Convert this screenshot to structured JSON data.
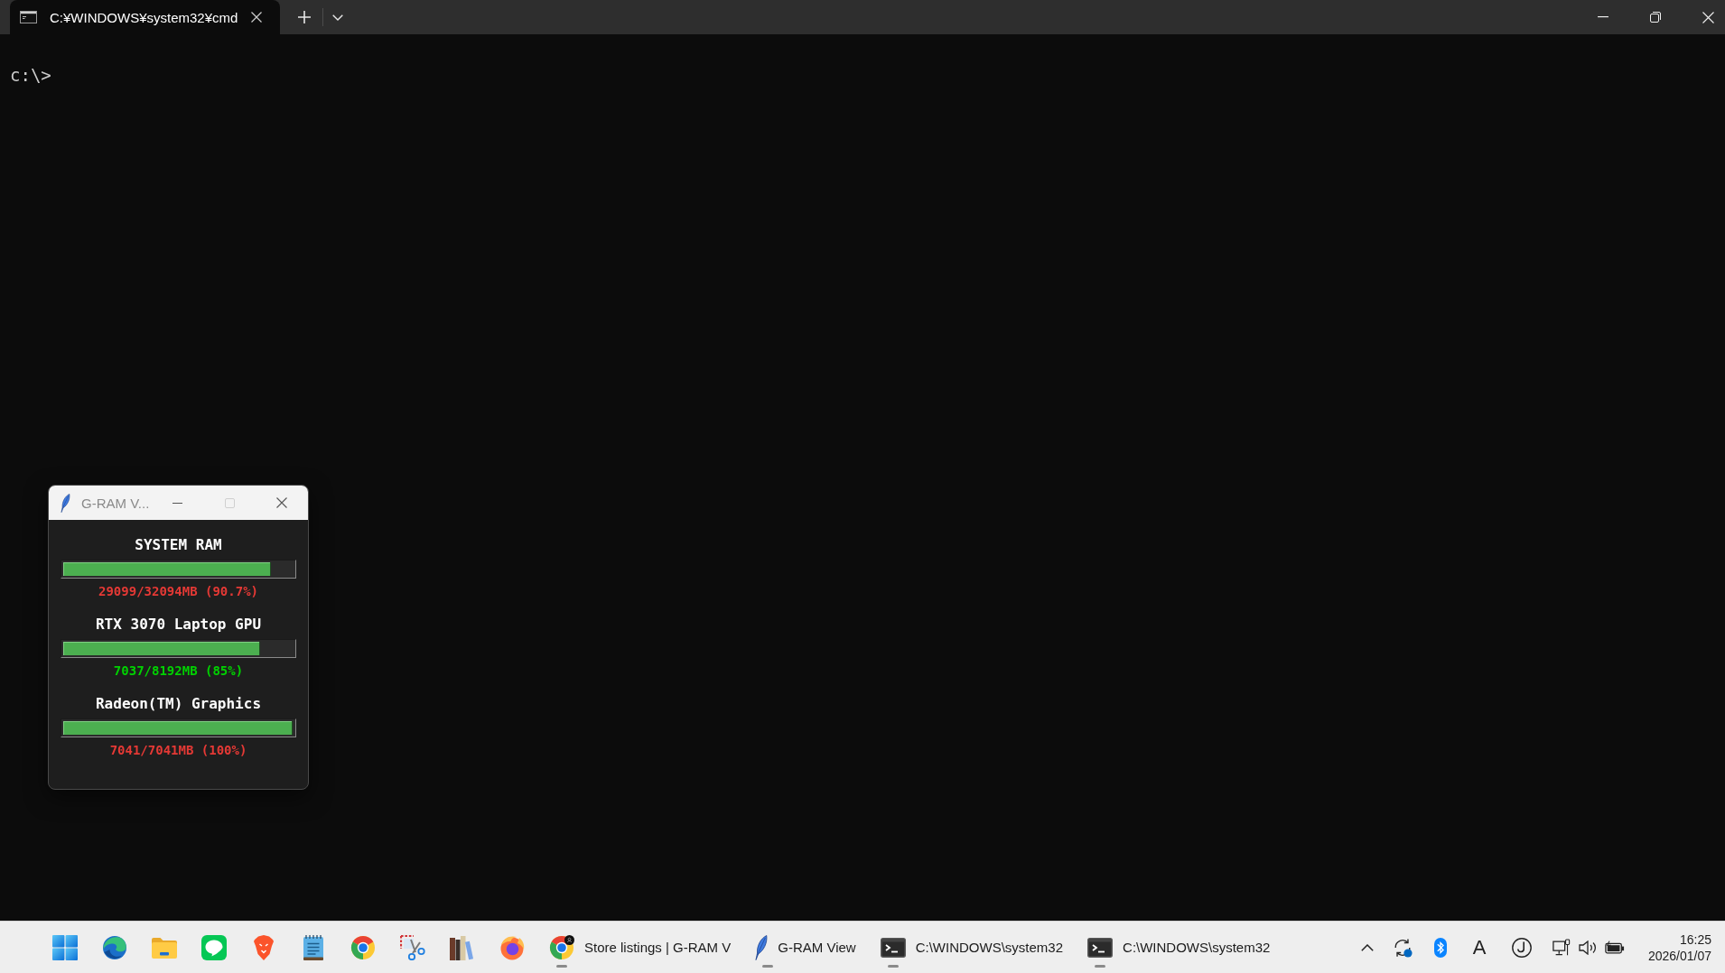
{
  "window": {
    "tabs": [
      {
        "title": "C:¥WINDOWS¥system32¥cmd",
        "selected": true
      }
    ]
  },
  "terminal": {
    "lines": [
      "c:\\>"
    ]
  },
  "gram_window": {
    "title": "G-RAM V...",
    "active": false,
    "maximize_disabled": true,
    "meters": [
      {
        "name": "SYSTEM RAM",
        "level": 0.907,
        "reading": "29099/32094MB (90.7%)",
        "color": "#e53935"
      },
      {
        "name": "RTX 3070 Laptop GPU",
        "level": 0.859,
        "reading": "7037/8192MB (85%)",
        "color": "#00d200"
      },
      {
        "name": "Radeon(TM) Graphics",
        "level": 1,
        "reading": "7041/7041MB (100%)",
        "color": "#e53935"
      }
    ]
  },
  "taskbar": {
    "apps": [
      {
        "open": false
      },
      {
        "open": false
      },
      {
        "open": false
      },
      {
        "open": false
      },
      {
        "open": false
      },
      {
        "open": false
      },
      {
        "open": false
      },
      {
        "open": false
      },
      {
        "open": false
      },
      {
        "label": "Store listings | G-RAM V",
        "open": true
      },
      {
        "label": "G-RAM View",
        "open": true
      },
      {
        "label": "C:\\WINDOWS\\system32",
        "open": true
      },
      {
        "label": "C:\\WINDOWS\\system32",
        "open": true
      }
    ]
  },
  "tray": {
    "ime_mode": "A"
  },
  "clock": {
    "time": "16:25",
    "date": "2026/01/07"
  }
}
